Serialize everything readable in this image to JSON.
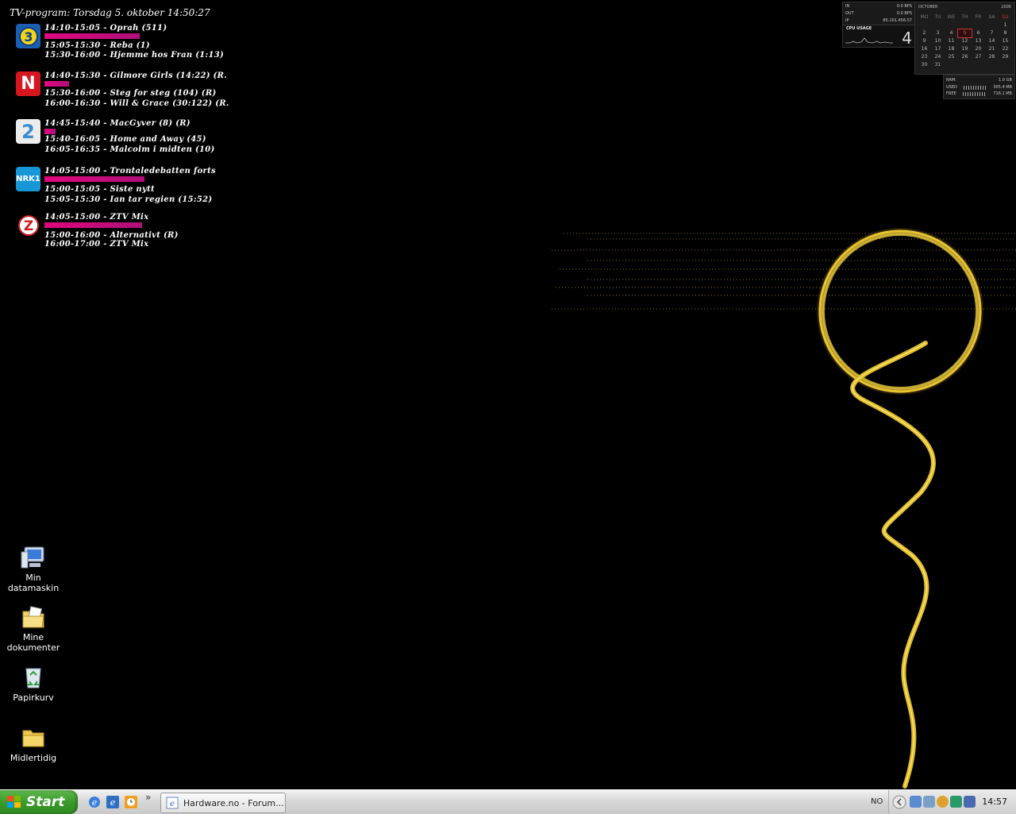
{
  "tv": {
    "title": "TV-program: Torsdag 5. oktober 14:50:27",
    "channels": [
      {
        "logo_text": "3",
        "logo_color": "#1b5fb4",
        "now": "14:10-15:05 - Oprah (511)",
        "progress": 0.73,
        "next1": "15:05-15:30 - Reba (1)",
        "next2": "15:30-16:00 - Hjemme hos Fran (1:13)"
      },
      {
        "logo_text": "N",
        "logo_color": "#d4171f",
        "now": "14:40-15:30 - Gilmore Girls (14:22) (R.",
        "progress": 0.25,
        "next1": "15:30-16:00 - Steg for steg (104) (R)",
        "next2": "16:00-16:30 - Will & Grace (30:122) (R."
      },
      {
        "logo_text": "2",
        "logo_color": "#e8e8e8",
        "now": "14:45-15:40 - MacGyver (8) (R)",
        "progress": 0.11,
        "next1": "15:40-16:05 - Home and Away (45)",
        "next2": "16:05-16:35 - Malcolm i midten (10)"
      },
      {
        "logo_text": "NRK1",
        "logo_color": "#1796d8",
        "now": "14:05-15:00 - Trontaledebatten forts",
        "progress": 0.83,
        "next1": "15:00-15:05 - Siste nytt",
        "next2": "15:05-15:30 - Ian tar regien (15:52)"
      },
      {
        "logo_text": "Z",
        "logo_color": "#ffffff",
        "now": "14:05-15:00 - ZTV Mix",
        "progress": 0.83,
        "next1": "15:00-16:00 - Alternativt (R)",
        "next2": "16:00-17:00 - ZTV Mix"
      }
    ]
  },
  "net": {
    "in_label": "IN",
    "in_value": "0.0 BPS",
    "out_label": "OUT",
    "out_value": "0.0 BPS",
    "ip_label": "IP",
    "ip_value": "85.101.456.57"
  },
  "cpu": {
    "label": "CPU USAGE",
    "value": "4"
  },
  "calendar": {
    "month": "OCTOBER",
    "year": "2006",
    "weekdays": [
      "MO",
      "TU",
      "WE",
      "TH",
      "FR",
      "SA",
      "SU"
    ],
    "days": [
      "",
      "",
      "",
      "",
      "",
      "",
      "1",
      "2",
      "3",
      "4",
      "5",
      "6",
      "7",
      "8",
      "9",
      "10",
      "11",
      "12",
      "13",
      "14",
      "15",
      "16",
      "17",
      "18",
      "19",
      "20",
      "21",
      "22",
      "23",
      "24",
      "25",
      "26",
      "27",
      "28",
      "29",
      "30",
      "31"
    ],
    "today": "5"
  },
  "ram": {
    "label": "RAM:",
    "total": "1.0 GB",
    "used_label": "USED",
    "used_value": "305.4 MB",
    "free_label": "FREE",
    "free_value": "716.1 MB"
  },
  "desktop_icons": [
    {
      "label": "Min datamaskin",
      "icon": "computer-icon"
    },
    {
      "label": "Mine dokumenter",
      "icon": "documents-folder-icon"
    },
    {
      "label": "Papirkurv",
      "icon": "recycle-bin-icon"
    },
    {
      "label": "Midlertidig",
      "icon": "folder-icon"
    }
  ],
  "taskbar": {
    "start_label": "Start",
    "task_label": "Hardware.no - Forum...",
    "overflow": "»",
    "lang": "NO",
    "clock": "14:57"
  }
}
